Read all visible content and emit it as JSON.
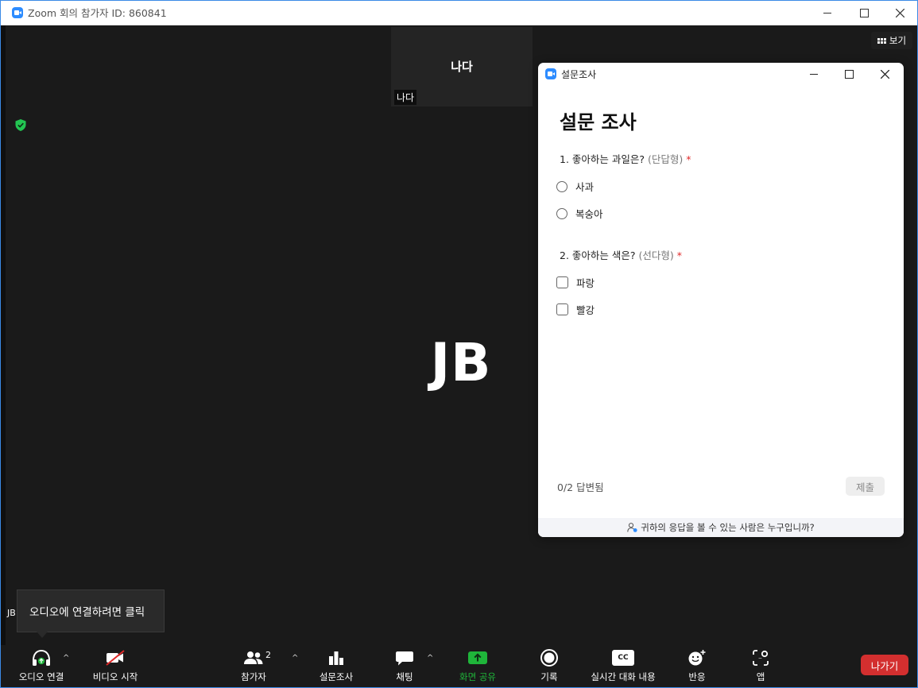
{
  "window": {
    "title": "Zoom 회의 참가자 ID: 860841"
  },
  "thumbnail": {
    "name": "나다",
    "label": "나다"
  },
  "view_button": {
    "label": "보기"
  },
  "main_video": {
    "initials": "JB",
    "name_label": "JB"
  },
  "tooltip": {
    "text": "오디오에 연결하려면 클릭"
  },
  "poll": {
    "window_title": "설문조사",
    "heading": "설문 조사",
    "questions": [
      {
        "number_text": "1. 좋아하는 과일은?",
        "type_hint": "(단답형)",
        "required_mark": "*",
        "options": [
          "사과",
          "복숭아"
        ]
      },
      {
        "number_text": "2. 좋아하는 색은?",
        "type_hint": "(선다형)",
        "required_mark": "*",
        "options": [
          "파랑",
          "빨강"
        ]
      }
    ],
    "answered_status": "0/2 답변됨",
    "submit_label": "제출",
    "footer_text": "귀하의 응답을 볼 수 있는 사람은 누구입니까?"
  },
  "toolbar": {
    "audio_label": "오디오 연결",
    "video_label": "비디오 시작",
    "participants_label": "참가자",
    "participants_count": "2",
    "polls_label": "설문조사",
    "chat_label": "채팅",
    "share_label": "화면 공유",
    "record_label": "기록",
    "captions_label": "실시간 대화 내용",
    "captions_icon_text": "CC",
    "reactions_label": "반응",
    "apps_label": "앱",
    "leave_label": "나가기",
    "caret": "^"
  },
  "colors": {
    "accent": "#2d8cff",
    "share_green": "#1fb53a",
    "leave_red": "#d32f2f",
    "shield_green": "#23c552",
    "required_red": "#e02828"
  }
}
